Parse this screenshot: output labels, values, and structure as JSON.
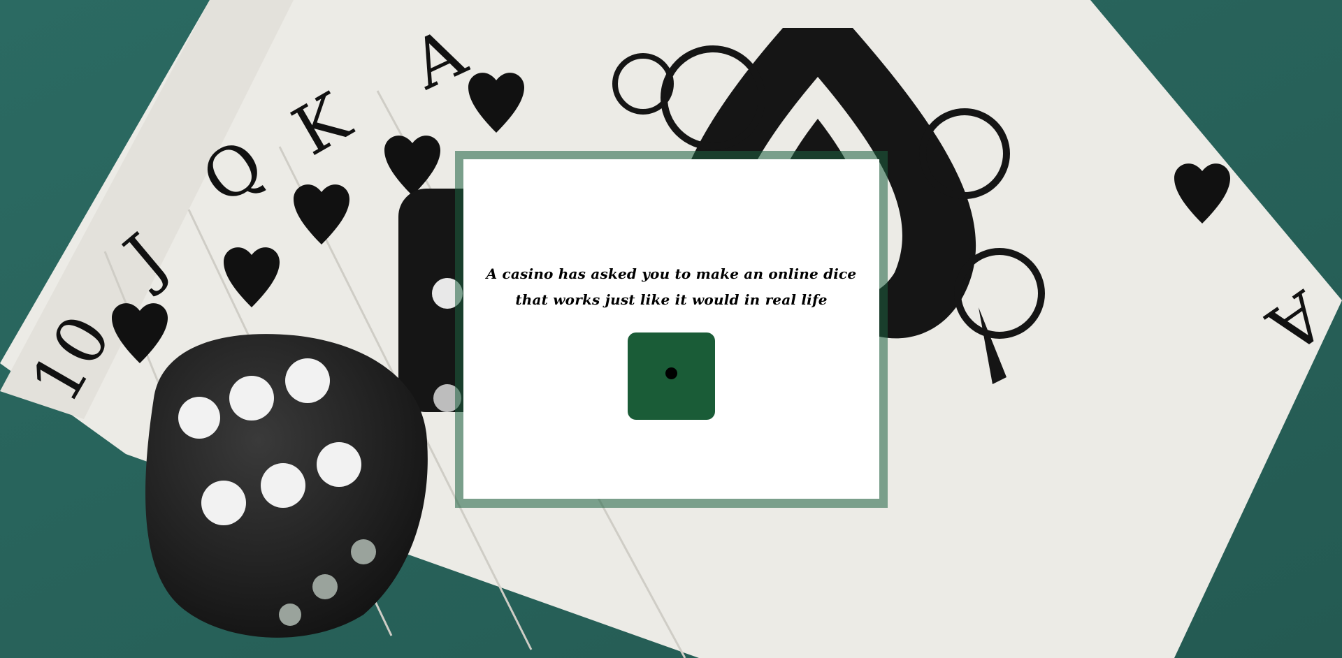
{
  "prompt": {
    "text": "A casino has asked you to make an online dice that works just like it would in real life"
  },
  "die": {
    "face_value": 1,
    "color": "#1a5c37",
    "pip_color": "#000000"
  },
  "background": {
    "table_color": "#2e6a60",
    "card_visible_ranks": [
      "10",
      "J",
      "Q",
      "K",
      "A"
    ],
    "large_card_corner": "A",
    "card_suit": "spade-icon"
  }
}
